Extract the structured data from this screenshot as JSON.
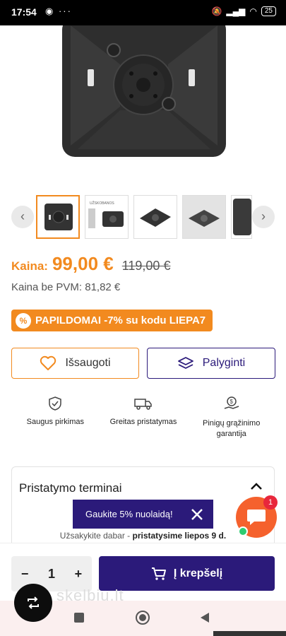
{
  "status_bar": {
    "time": "17:54",
    "battery": "25"
  },
  "thumbnails": {
    "count": 5,
    "active_index": 0,
    "thumb2_caption": "UŽSKOBANOS"
  },
  "price": {
    "label": "Kaina:",
    "value": "99,00 €",
    "old_value": "119,00 €",
    "without_vat": "Kaina be PVM: 81,82 €"
  },
  "promo": {
    "text": "PAPILDOMAI -7% su kodu LIEPA7"
  },
  "actions": {
    "save_label": "Išsaugoti",
    "compare_label": "Palyginti"
  },
  "features": [
    {
      "label": "Saugus pirkimas",
      "icon": "shield-check-icon"
    },
    {
      "label": "Greitas pristatymas",
      "icon": "truck-icon"
    },
    {
      "label": "Pinigų grąžinimo garantija",
      "icon": "money-back-icon"
    }
  ],
  "delivery": {
    "title": "Pristatymo terminai",
    "text_prefix": "Užsakykite dabar - ",
    "text_bold": "pristatysime liepos 9 d."
  },
  "toast": {
    "text": "Gaukite 5% nuolaidą!"
  },
  "chat": {
    "badge": "1"
  },
  "cart": {
    "quantity": "1",
    "minus": "−",
    "plus": "+",
    "add_label": "Į krepšelį"
  },
  "watermark": {
    "text": "skelbiu.lt"
  },
  "colors": {
    "accent_orange": "#f28a1f",
    "brand_purple": "#2b1a7a",
    "chat_orange": "#f5612d"
  }
}
